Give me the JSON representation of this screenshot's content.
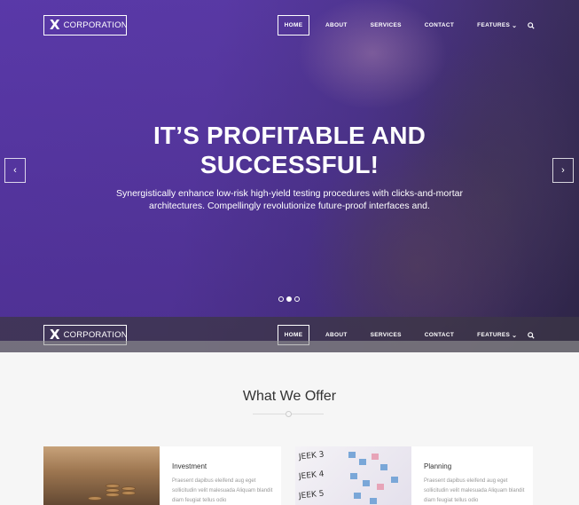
{
  "brand": {
    "mark": "X",
    "name": "CORPORATION"
  },
  "nav": {
    "items": [
      "HOME",
      "ABOUT",
      "SERVICES",
      "CONTACT",
      "FEATURES"
    ],
    "features_caret": "⌄",
    "search_glyph": "⌕"
  },
  "hero": {
    "title_line1": "IT’S PROFITABLE AND",
    "title_line2": "SUCCESSFUL!",
    "subtitle": "Synergistically enhance low-risk high-yield testing procedures with clicks-and-mortar architectures. Compellingly revolutionize future-proof interfaces and.",
    "prev": "‹",
    "next": "›",
    "slide_count": 3,
    "active_slide": 2
  },
  "offer": {
    "title": "What We Offer",
    "cards": [
      {
        "title": "Investment",
        "text": "Praesent dapibus eleifend aug eget sollicitudin velit malesuada Aliquam blandit diam feugiat tellus odio"
      },
      {
        "title": "Planning",
        "text": "Praesent dapibus eleifend aug eget sollicitudin velit malesuada Aliquam blandit diam feugiat tellus odio"
      }
    ],
    "board_words": [
      "JEEK 3",
      "JEEK 4",
      "JEEK 5"
    ]
  }
}
